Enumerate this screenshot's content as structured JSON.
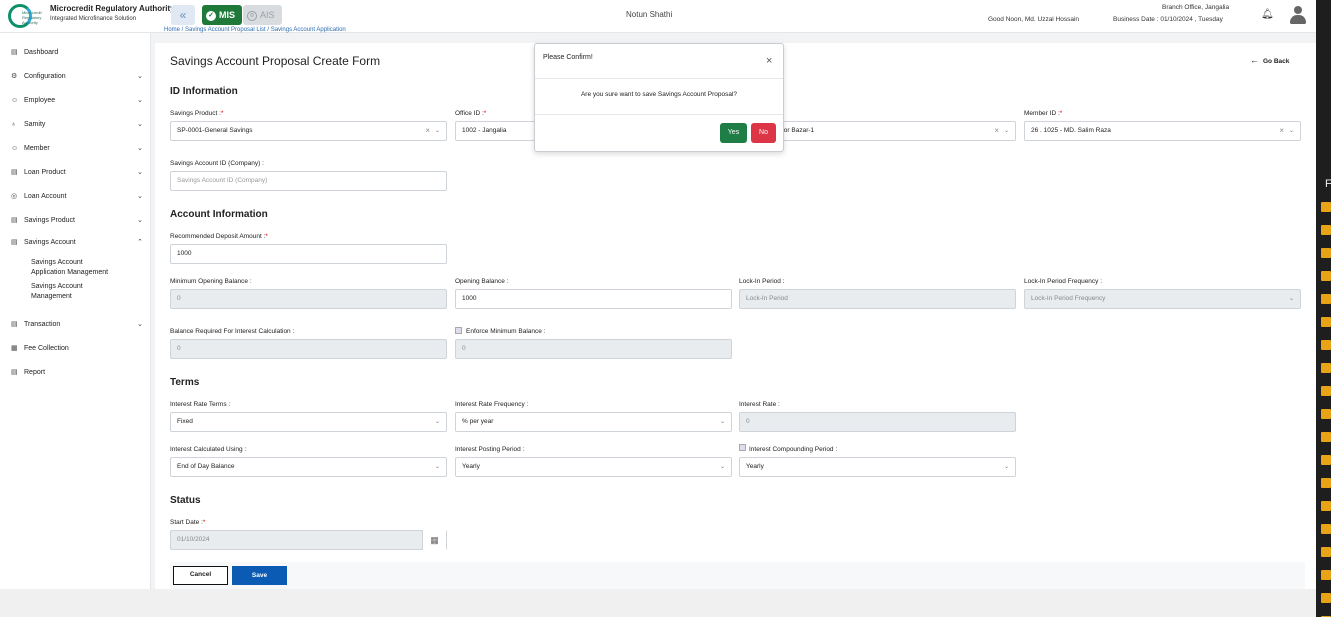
{
  "header": {
    "org_title": "Microcredit Regulatory Authority",
    "org_subtitle": "Integrated Microfinance Solution",
    "logo_text": "Microcredit Regulatory Authority",
    "collapse_icon": "«",
    "mis_label": "MIS",
    "ais_label": "AIS",
    "app_name": "Notun Shathi",
    "greeting": "Good Noon, Md. Uzzal Hossain",
    "branch": "Branch Office, Jangalia",
    "business_date": "Business Date : 01/10/2024 , Tuesday"
  },
  "breadcrumb": "Home / Savings Account Proposal List / Savings Account Application",
  "sidebar": {
    "items": [
      {
        "label": "Dashboard",
        "icon": "dashboard-icon",
        "glyph": "▤",
        "chevron": ""
      },
      {
        "label": "Configuration",
        "icon": "configuration-icon",
        "glyph": "⚙",
        "chevron": "⌄"
      },
      {
        "label": "Employee",
        "icon": "employee-icon",
        "glyph": "☺",
        "chevron": "⌄"
      },
      {
        "label": "Samity",
        "icon": "samity-icon",
        "glyph": "♁",
        "chevron": "⌄"
      },
      {
        "label": "Member",
        "icon": "member-icon",
        "glyph": "☺",
        "chevron": "⌄"
      },
      {
        "label": "Loan Product",
        "icon": "loan-product-icon",
        "glyph": "▤",
        "chevron": "⌄"
      },
      {
        "label": "Loan Account",
        "icon": "loan-account-icon",
        "glyph": "◎",
        "chevron": "⌄"
      },
      {
        "label": "Savings Product",
        "icon": "savings-product-icon",
        "glyph": "▤",
        "chevron": "⌄"
      },
      {
        "label": "Savings Account",
        "icon": "savings-account-icon",
        "glyph": "▤",
        "chevron": "⌃"
      },
      {
        "label": "Transaction",
        "icon": "transaction-icon",
        "glyph": "▤",
        "chevron": "⌄"
      },
      {
        "label": "Fee Collection",
        "icon": "fee-collection-icon",
        "glyph": "▦",
        "chevron": ""
      },
      {
        "label": "Report",
        "icon": "report-icon",
        "glyph": "▤",
        "chevron": ""
      }
    ],
    "sub_items": [
      {
        "line1": "Savings Account",
        "line2": "Application Management"
      },
      {
        "line1": "Savings Account",
        "line2": "Management"
      }
    ]
  },
  "page": {
    "title": "Savings Account Proposal Create Form",
    "go_back": "Go Back"
  },
  "form": {
    "sections": {
      "id_info": "ID Information",
      "account_info": "Account Information",
      "terms": "Terms",
      "status": "Status"
    },
    "savings_product": {
      "label": "Savings Product :",
      "value": "SP-0001-General Savings"
    },
    "office_id": {
      "label": "Office ID :",
      "value": "1002 - Jangalia"
    },
    "samity_value": "for Bazar-1",
    "member_id": {
      "label": "Member ID :",
      "value": "26 . 1025 - MD. Salim Raza"
    },
    "savings_account_id": {
      "label": "Savings Account ID (Company) :",
      "placeholder": "Savings Account ID (Company)"
    },
    "recommended_deposit": {
      "label": "Recommended Deposit Amount :",
      "value": "1000"
    },
    "min_opening_balance": {
      "label": "Minimum Opening Balance :",
      "value": "0"
    },
    "opening_balance": {
      "label": "Opening Balance :",
      "value": "1000"
    },
    "lock_in_period": {
      "label": "Lock-In Period :",
      "placeholder": "Lock-In Period"
    },
    "lock_in_frequency": {
      "label": "Lock-In Period Frequency :",
      "placeholder": "Lock-In Period Frequency"
    },
    "balance_required": {
      "label": "Balance Required For Interest Calculation :",
      "value": "0"
    },
    "enforce_min_balance": {
      "label": "Enforce Minimum Balance :",
      "value": "0",
      "checked": true
    },
    "interest_rate_terms": {
      "label": "Interest Rate Terms :",
      "value": "Fixed"
    },
    "interest_rate_frequency": {
      "label": "Interest Rate Frequency :",
      "value": "% per year"
    },
    "interest_rate": {
      "label": "Interest Rate :",
      "value": "0"
    },
    "interest_calculated_using": {
      "label": "Interest Calculated Using :",
      "value": "End of Day Balance"
    },
    "interest_posting_period": {
      "label": "Interest Posting Period :",
      "value": "Yearly"
    },
    "interest_compounding_period": {
      "label": "Interest Compounding Period :",
      "value": "Yearly",
      "checked": true
    },
    "start_date": {
      "label": "Start Date :",
      "value": "01/10/2024"
    },
    "required_mark": "*",
    "clear_glyph": "×",
    "caret_glyph": "⌄",
    "calendar_glyph": "▦"
  },
  "buttons": {
    "cancel": "Cancel",
    "save": "Save"
  },
  "dialog": {
    "title": "Please Confirm!",
    "close": "×",
    "message": "Are you sure want to save Savings Account Proposal?",
    "yes": "Yes",
    "no": "No"
  },
  "right_strip": {
    "letter": "F"
  },
  "colors": {
    "primary": "#0b5bb5",
    "mis_green": "#1f7a3a",
    "yes_green": "#1e7e45",
    "no_red": "#dc3545",
    "required_red": "#dd0000"
  }
}
